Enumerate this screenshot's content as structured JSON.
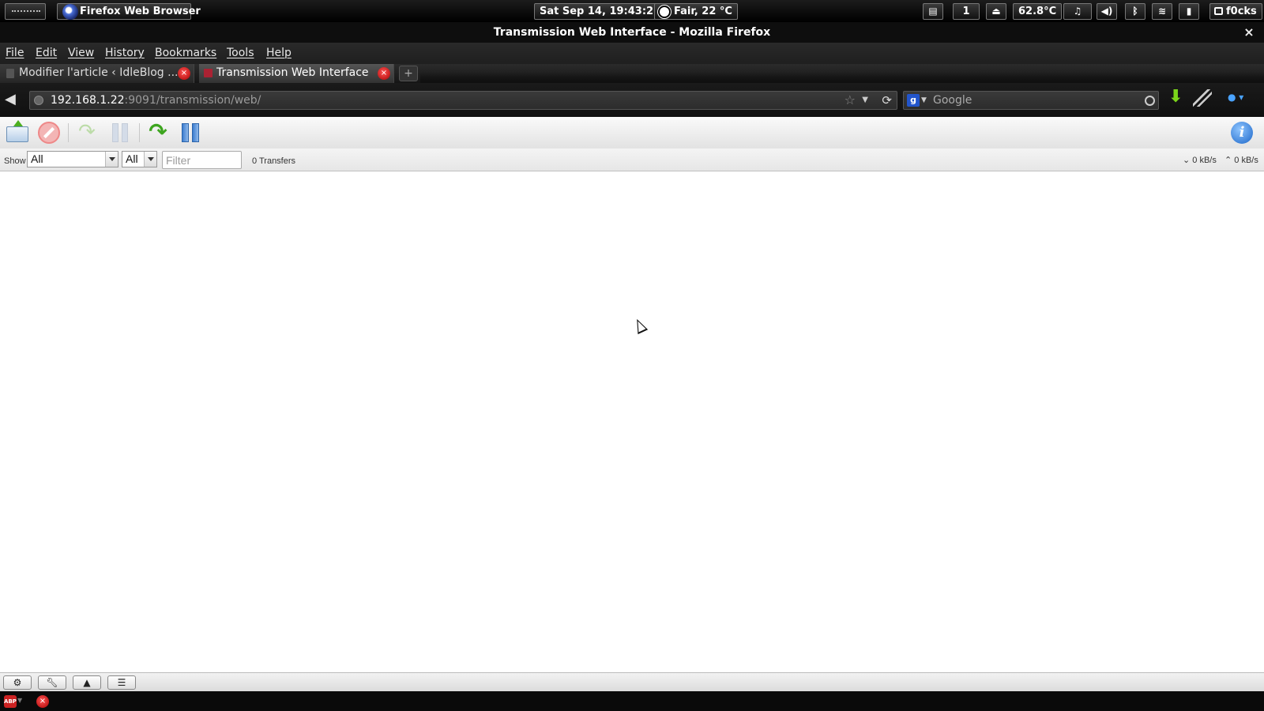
{
  "system_panel": {
    "app_title": "Firefox Web Browser",
    "clock": "Sat Sep 14, 19:43:25",
    "weather": "Fair, 22 °C",
    "workspace": "1",
    "temperature": "62.8°C",
    "user": "f0cks",
    "icons": [
      "menu-icon",
      "folder-icon",
      "eject-icon",
      "music-icon",
      "volume-icon",
      "bluetooth-icon",
      "wifi-icon",
      "battery-icon"
    ]
  },
  "window": {
    "title": "Transmission Web Interface - Mozilla Firefox",
    "close_glyph": "×"
  },
  "menubar": {
    "items": [
      "File",
      "Edit",
      "View",
      "History",
      "Bookmarks",
      "Tools",
      "Help"
    ]
  },
  "tabs": [
    {
      "label": "Modifier l'article ‹ IdleBlog ...",
      "active": false
    },
    {
      "label": "Transmission Web Interface",
      "active": true
    }
  ],
  "navbar": {
    "url_host": "192.168.1.22",
    "url_rest": ":9091/transmission/web/",
    "search_placeholder": "Google"
  },
  "filterbar": {
    "show_label": "Show",
    "state_filter": "All",
    "tracker_filter": "All",
    "filter_placeholder": "Filter",
    "transfers": "0 Transfers",
    "download_speed": "0 kB/s",
    "upload_speed": "0 kB/s"
  },
  "colors": {
    "accent_green": "#3da51f",
    "accent_blue": "#1c66c8",
    "chrome_dark": "#1a1a1a"
  }
}
